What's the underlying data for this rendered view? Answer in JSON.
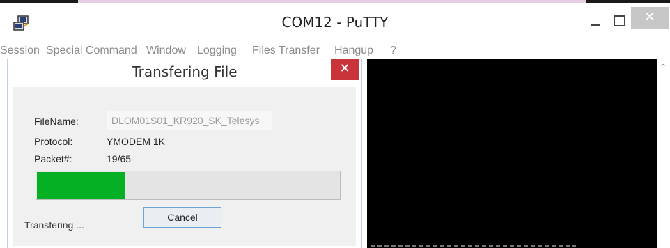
{
  "window": {
    "title": "COM12 - PuTTY",
    "close_glyph": "✕"
  },
  "menu": [
    {
      "label": "Session"
    },
    {
      "label": "Special Command"
    },
    {
      "label": "Window"
    },
    {
      "label": "Logging"
    },
    {
      "label": "Files Transfer"
    },
    {
      "label": "Hangup"
    },
    {
      "label": "?"
    }
  ],
  "dialog": {
    "title": "Transfering File",
    "close_glyph": "✕",
    "labels": {
      "filename": "FileName:",
      "protocol": "Protocol:",
      "packet": "Packet#:"
    },
    "filename_value": "DLOM01S01_KR920_SK_Telesys",
    "protocol_value": "YMODEM 1K",
    "packet_value": "19/65",
    "progress_fraction": 0.2923,
    "cancel_label": "Cancel",
    "status": "Transfering ..."
  },
  "colors": {
    "progress": "#06b025",
    "terminal": "#000000",
    "dialog_close": "#c9343a"
  },
  "icons": {
    "app": "putty-icon",
    "minimize": "minimize-icon",
    "maximize": "maximize-icon",
    "close": "close-icon",
    "scroll_up": "chevron-up-icon"
  }
}
